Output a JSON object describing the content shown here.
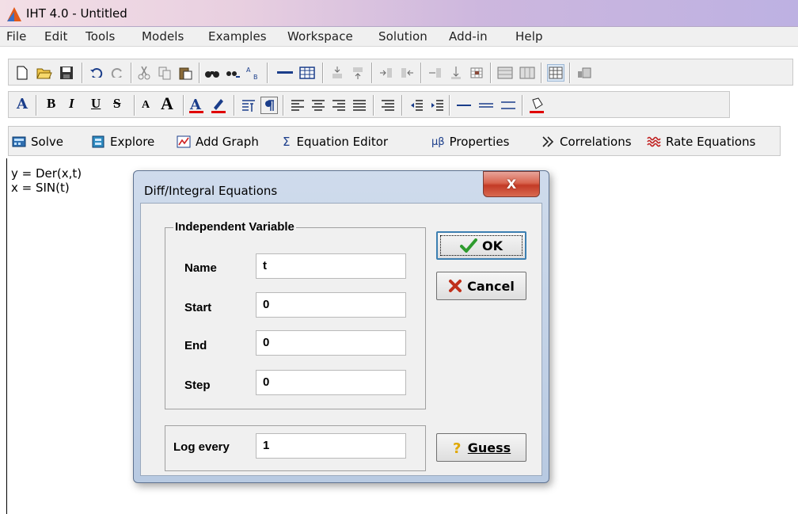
{
  "window": {
    "title": "IHT 4.0 - Untitled"
  },
  "menu": [
    "File",
    "Edit",
    "Tools",
    "Models",
    "Examples",
    "Workspace",
    "Solution",
    "Add-in",
    "Help"
  ],
  "toolbar3": [
    {
      "icon": "solve-icon",
      "label": "Solve"
    },
    {
      "icon": "explore-icon",
      "label": "Explore"
    },
    {
      "icon": "add-graph-icon",
      "label": "Add Graph"
    },
    {
      "icon": "sigma-icon",
      "label": "Equation Editor"
    },
    {
      "icon": "properties-icon",
      "label": "Properties"
    },
    {
      "icon": "correlations-icon",
      "label": "Correlations"
    },
    {
      "icon": "rate-equations-icon",
      "label": "Rate Equations"
    }
  ],
  "toolbar3_glyphs": {
    "sigma": "Σ",
    "props": "μβ"
  },
  "toolbar2_glyphs": {
    "font": "A",
    "bold": "B",
    "italic": "I",
    "underline": "U",
    "strike": "S",
    "smaller": "A",
    "larger": "A"
  },
  "equations": [
    "y = Der(x,t)",
    "x = SIN(t)"
  ],
  "dialog": {
    "title": "Diff/Integral Equations",
    "close": "X",
    "group_label": "Independent Variable",
    "fields": [
      {
        "label": "Name",
        "value": "t"
      },
      {
        "label": "Start",
        "value": "0"
      },
      {
        "label": "End",
        "value": "0"
      },
      {
        "label": "Step",
        "value": "0"
      }
    ],
    "log": {
      "label": "Log every",
      "value": "1"
    },
    "ok": "OK",
    "cancel": "Cancel",
    "guess": "Guess"
  },
  "colors": {
    "accent": "#3c7fb1",
    "close": "#c33a26",
    "check": "#2e9b2e",
    "cancel_x": "#c0301a",
    "guess_q": "#e0a800"
  }
}
